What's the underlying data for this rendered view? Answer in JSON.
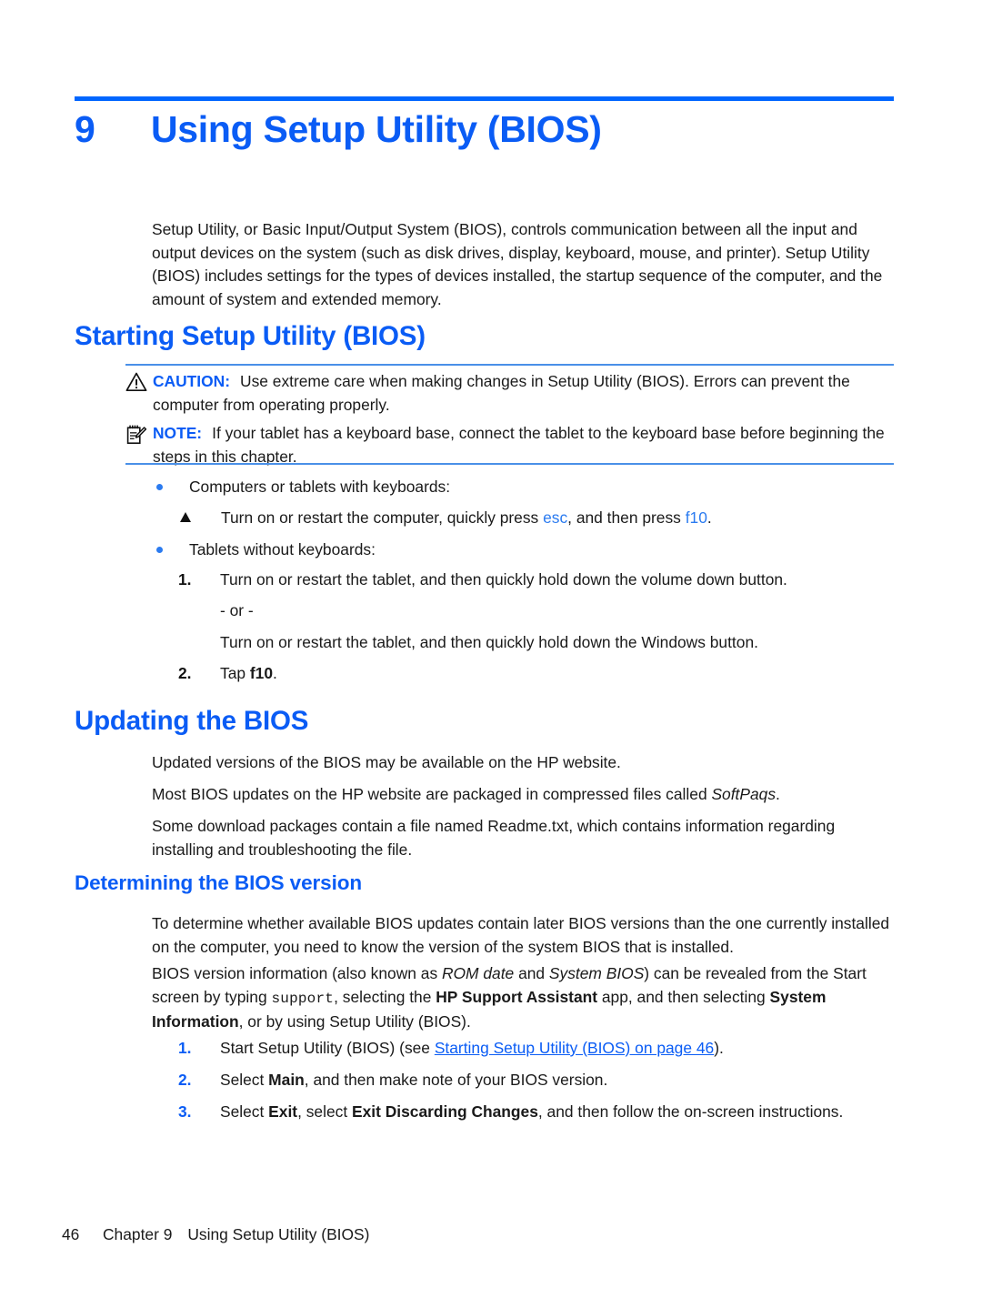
{
  "chapter": {
    "number": "9",
    "title": "Using Setup Utility (BIOS)",
    "accent_color": "#0a5cf5",
    "rule_color": "#0066ff"
  },
  "intro": {
    "paragraph": "Setup Utility, or Basic Input/Output System (BIOS), controls communication between all the input and output devices on the system (such as disk drives, display, keyboard, mouse, and printer). Setup Utility (BIOS) includes settings for the types of devices installed, the startup sequence of the computer, and the amount of system and extended memory."
  },
  "section_starting": {
    "heading": "Starting Setup Utility (BIOS)",
    "caution": {
      "icon": "warning-triangle-icon",
      "label": "CAUTION:",
      "text": "Use extreme care when making changes in Setup Utility (BIOS). Errors can prevent the computer from operating properly."
    },
    "note": {
      "icon": "notepad-pencil-icon",
      "label": "NOTE:",
      "text": "If your tablet has a keyboard base, connect the tablet to the keyboard base before beginning the steps in this chapter."
    },
    "bullet_1": "Computers or tablets with keyboards:",
    "triangle_step": {
      "prefix": "Turn on or restart the computer, quickly press ",
      "key1": "esc",
      "middle": ", and then press ",
      "key2": "f10",
      "suffix": "."
    },
    "bullet_2": "Tablets without keyboards:",
    "steps": [
      {
        "number": "1.",
        "text": "Turn on or restart the tablet, and then quickly hold down the volume down button."
      },
      {
        "number": "2.",
        "prefix": "Tap ",
        "bold": "f10",
        "suffix": "."
      }
    ],
    "or_separator": "- or -",
    "alt_step": "Turn on or restart the tablet, and then quickly hold down the Windows button."
  },
  "section_updating": {
    "heading": "Updating the BIOS",
    "para_1": "Updated versions of the BIOS may be available on the HP website.",
    "para_2": {
      "prefix": "Most BIOS updates on the HP website are packaged in compressed files called ",
      "italic": "SoftPaqs",
      "suffix": "."
    },
    "para_3": "Some download packages contain a file named Readme.txt, which contains information regarding installing and troubleshooting the file."
  },
  "section_determining": {
    "heading": "Determining the BIOS version",
    "para_1": "To determine whether available BIOS updates contain later BIOS versions than the one currently installed on the computer, you need to know the version of the system BIOS that is installed.",
    "para_2": {
      "s1": "BIOS version information (also known as ",
      "i1": "ROM date",
      "s2": " and ",
      "i2": "System BIOS",
      "s3": ") can be revealed from the Start screen by typing ",
      "mono": "support",
      "s4": ", selecting the ",
      "b1": "HP Support Assistant",
      "s5": " app, and then selecting ",
      "b2": "System Information",
      "s6": ", or by using Setup Utility (BIOS)."
    },
    "steps": [
      {
        "number": "1.",
        "prefix": "Start Setup Utility (BIOS) (see ",
        "link": "Starting Setup Utility (BIOS) on page 46",
        "suffix": ")."
      },
      {
        "number": "2.",
        "prefix": "Select ",
        "bold": "Main",
        "suffix": ", and then make note of your BIOS version."
      },
      {
        "number": "3.",
        "prefix": "Select ",
        "bold1": "Exit",
        "middle": ", select ",
        "bold2": "Exit Discarding Changes",
        "suffix": ", and then follow the on-screen instructions."
      }
    ]
  },
  "footer": {
    "page_number": "46",
    "chapter_label": "Chapter 9",
    "chapter_title": "Using Setup Utility (BIOS)"
  }
}
